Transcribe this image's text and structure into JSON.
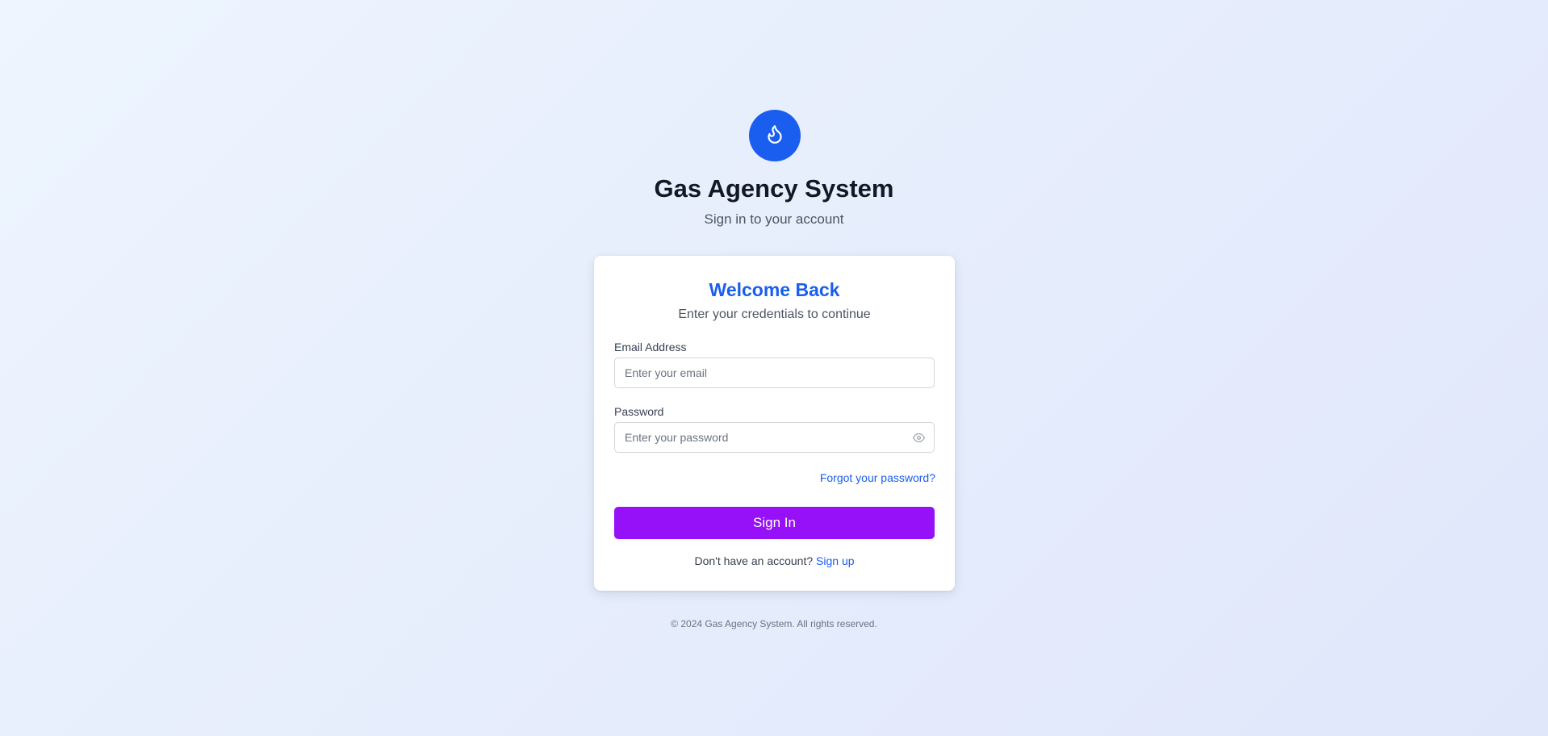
{
  "brand": {
    "title": "Gas Agency System",
    "subtitle": "Sign in to your account",
    "logo_icon": "flame-icon",
    "brand_color": "#1a5ef0"
  },
  "login_card": {
    "title": "Welcome Back",
    "subtitle": "Enter your credentials to continue",
    "email": {
      "label": "Email Address",
      "placeholder": "Enter your email",
      "value": ""
    },
    "password": {
      "label": "Password",
      "placeholder": "Enter your password",
      "value": "",
      "toggle_icon": "eye-icon"
    },
    "forgot_password_link": "Forgot your password?",
    "submit_button": {
      "label": "Sign In",
      "color": "#9610f8"
    },
    "signup_prompt": "Don't have an account?",
    "signup_link": "Sign up"
  },
  "footer": {
    "copyright": "© 2024 Gas Agency System. All rights reserved."
  }
}
